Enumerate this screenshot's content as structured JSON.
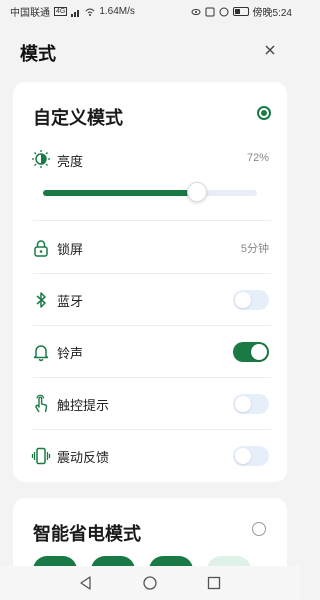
{
  "status_bar": {
    "carrier": "中国联通",
    "network": "4G",
    "speed": "1.64M/s",
    "time_label": "傍晚5:24"
  },
  "header": {
    "title": "模式"
  },
  "custom_mode": {
    "title": "自定义模式",
    "selected": true,
    "brightness": {
      "label": "亮度",
      "value_text": "72%",
      "level": 0.72
    },
    "settings": [
      {
        "label": "锁屏",
        "value": "5分钟",
        "type": "value"
      },
      {
        "label": "蓝牙",
        "type": "toggle",
        "on": false
      },
      {
        "label": "铃声",
        "type": "toggle",
        "on": true
      },
      {
        "label": "触控提示",
        "type": "toggle",
        "on": false
      },
      {
        "label": "震动反馈",
        "type": "toggle",
        "on": false
      }
    ]
  },
  "power_saving_mode": {
    "title": "智能省电模式",
    "selected": false
  },
  "colors": {
    "accent": "#1a7a45",
    "toggle_off": "#e6eefa",
    "background": "#f3f3f3"
  }
}
